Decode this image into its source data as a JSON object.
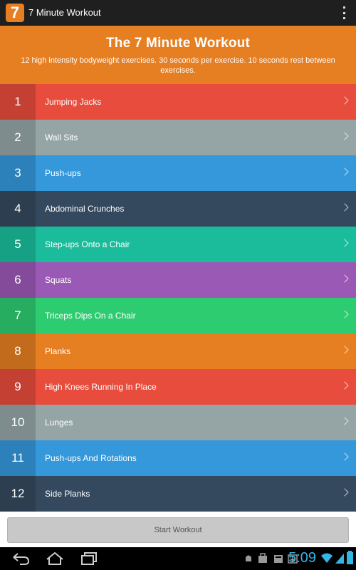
{
  "action_bar": {
    "app_icon_text": "7",
    "title": "7 Minute Workout"
  },
  "header": {
    "title": "The 7 Minute Workout",
    "subtitle": "12 high intensity bodyweight exercises. 30 seconds per exercise. 10 seconds rest between exercises."
  },
  "exercises": [
    {
      "number": "1",
      "name": "Jumping Jacks",
      "color": "#e74c3c"
    },
    {
      "number": "2",
      "name": "Wall Sits",
      "color": "#95a5a6"
    },
    {
      "number": "3",
      "name": "Push-ups",
      "color": "#3498db"
    },
    {
      "number": "4",
      "name": "Abdominal Crunches",
      "color": "#34495e"
    },
    {
      "number": "5",
      "name": "Step-ups Onto a Chair",
      "color": "#1abc9c"
    },
    {
      "number": "6",
      "name": "Squats",
      "color": "#9b59b6"
    },
    {
      "number": "7",
      "name": "Triceps Dips On a Chair",
      "color": "#2ecc71"
    },
    {
      "number": "8",
      "name": "Planks",
      "color": "#e67e22"
    },
    {
      "number": "9",
      "name": "High Knees Running In Place",
      "color": "#e74c3c"
    },
    {
      "number": "10",
      "name": "Lunges",
      "color": "#95a5a6"
    },
    {
      "number": "11",
      "name": "Push-ups And Rotations",
      "color": "#3498db"
    },
    {
      "number": "12",
      "name": "Side Planks",
      "color": "#34495e"
    }
  ],
  "footer": {
    "start_button_label": "Start Workout"
  },
  "status_bar": {
    "time": "5:09",
    "accent_color": "#33b5e5"
  },
  "icons": {
    "back": "back-icon",
    "home": "home-icon",
    "recent": "recent-apps-icon",
    "overflow": "overflow-menu-icon",
    "chevron": "chevron-right-icon"
  }
}
